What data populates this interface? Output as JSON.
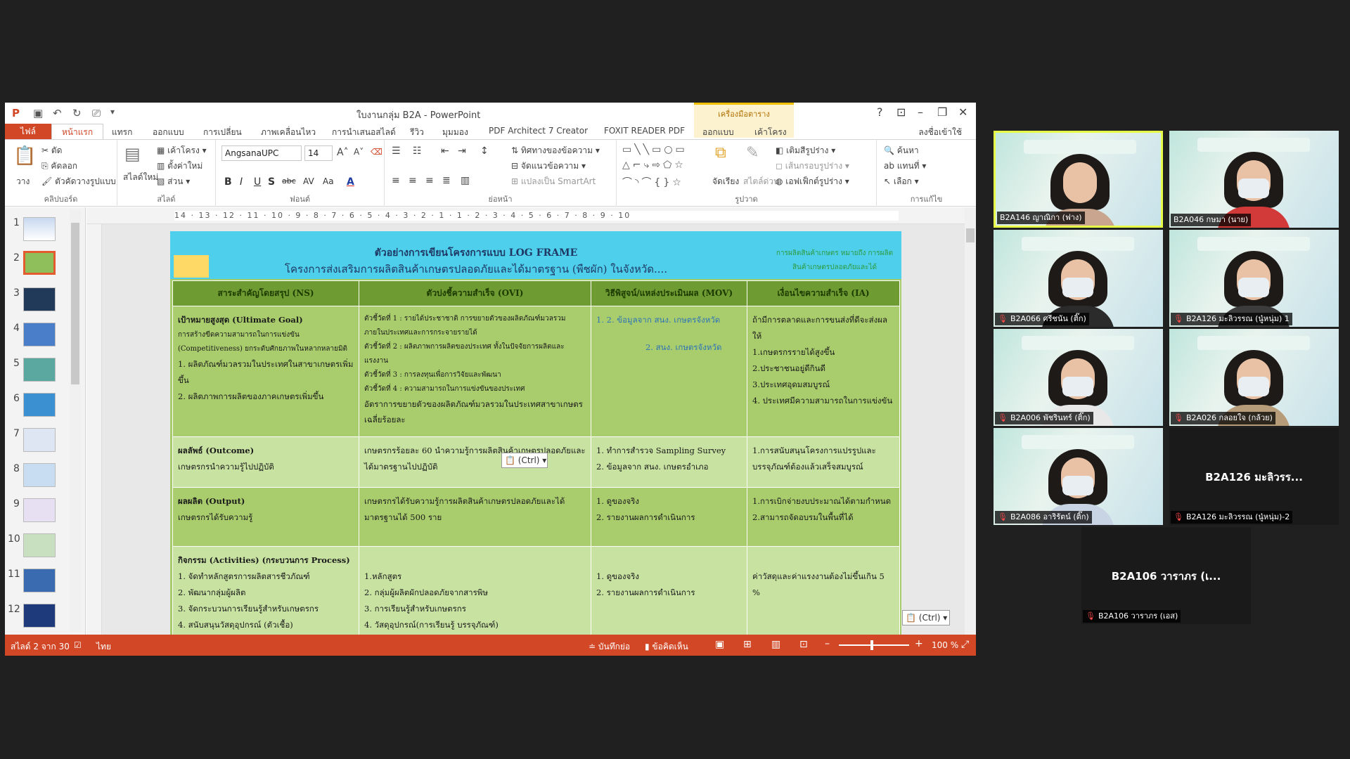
{
  "window": {
    "title": "ใบงานกลุ่ม B2A - PowerPoint",
    "context_tools": "เครื่องมือตาราง"
  },
  "tabs": [
    "ไฟล์",
    "หน้าแรก",
    "แทรก",
    "ออกแบบ",
    "การเปลี่ยน",
    "ภาพเคลื่อนไหว",
    "การนำเสนอสไลด์",
    "รีวิว",
    "มุมมอง",
    "PDF Architect 7 Creator",
    "FOXIT READER PDF",
    "ออกแบบ",
    "เค้าโครง"
  ],
  "signin": "ลงชื่อเข้าใช้",
  "ribbon": {
    "clipboard": {
      "label": "คลิปบอร์ด",
      "paste": "วาง",
      "cut": "ตัด",
      "copy": "คัดลอก",
      "format_painter": "ตัวคัดวางรูปแบบ"
    },
    "slides": {
      "label": "สไลด์",
      "new_slide": "สไลด์ใหม่",
      "layout": "เค้าโครง",
      "reset": "ตั้งค่าใหม่",
      "section": "ส่วน"
    },
    "font": {
      "label": "ฟอนต์",
      "name": "AngsanaUPC",
      "size": "14"
    },
    "paragraph": {
      "label": "ย่อหน้า",
      "text_direction": "ทิศทางของข้อความ",
      "align_text": "จัดแนวข้อความ",
      "smartart": "แปลงเป็น SmartArt"
    },
    "drawing": {
      "label": "รูปวาด",
      "arrange": "จัดเรียง",
      "quick_styles": "สไตล์ด่วน",
      "shape_fill": "เติมสีรูปร่าง",
      "shape_outline": "เส้นกรอบรูปร่าง",
      "shape_effects": "เอฟเฟ็กต์รูปร่าง"
    },
    "editing": {
      "label": "การแก้ไข",
      "find": "ค้นหา",
      "replace": "แทนที่",
      "select": "เลือก"
    }
  },
  "thumbnails": [
    "1",
    "2",
    "3",
    "4",
    "5",
    "6",
    "7",
    "8",
    "9",
    "10",
    "11",
    "12"
  ],
  "ruler_text": "14 · 13 · 12 · 11 · 10 · 9 · 8 · 7 · 6 · 5 · 4 · 3 · 2 · 1 · 1 · 2 · 3 · 4 · 5 · 6 · 7 · 8 · 9 · 10",
  "slide": {
    "title1": "ตัวอย่างการเขียนโครงการแบบ LOG FRAME",
    "title2": "โครงการส่งเสริมการผลิตสินค้าเกษตรปลอดภัยและได้มาตรฐาน (พืชผัก) ในจังหวัด....",
    "side_note": "การผลิตสินค้าเกษตร หมายถึง การผลิตสินค้าเกษตรปลอดภัยและได้",
    "headers": [
      "สาระสำคัญโดยสรุป (NS)",
      "ตัวบ่งชี้ความสำเร็จ (OVI)",
      "วิธีพิสูจน์/แหล่งประเมินผล (MOV)",
      "เงื่อนไขความสำเร็จ (IA)"
    ],
    "r1": {
      "ns_title": "เป้าหมายสูงสุด (Ultimate Goal)",
      "ns_lines": [
        "การสร้างขีดความสามารถในการแข่งขัน (Competitiveness) ยกระดับศักยภาพในหลากหลายมิติ",
        "1. ผลิตภัณฑ์มวลรวมในประเทศในสาขาเกษตรเพิ่มขึ้น",
        "2. ผลิตภาพการผลิตของภาคเกษตรเพิ่มขึ้น"
      ],
      "ovi_lines": [
        "ตัวชี้วัดที่ 1 : รายได้ประชาชาติ การขยายตัวของผลิตภัณฑ์มวลรวมภายในประเทศและการกระจายรายได้",
        "ตัวชี้วัดที่ 2 : ผลิตภาพการผลิตของประเทศ ทั้งในปัจจัยการผลิตและแรงงาน",
        "ตัวชี้วัดที่ 3 : การลงทุนเพื่อการวิจัยและพัฒนา",
        "ตัวชี้วัดที่ 4 : ความสามารถในการแข่งขันของประเทศ",
        "อัตราการขยายตัวของผลิตภัณฑ์มวลรวมในประเทศสาขาเกษตรเฉลี่ยร้อยละ"
      ],
      "mov_lines": [
        "1. 2. ข้อมูลจาก สนง. เกษตรจังหวัด",
        "2. สนง. เกษตรจังหวัด"
      ],
      "ia_lines": [
        "ถ้ามีการตลาดและการขนส่งที่ดีจะส่งผลให้",
        "1.เกษตรกรรายได้สูงขึ้น",
        "2.ประชาชนอยู่ดีกินดี",
        "3.ประเทศอุดมสมบูรณ์",
        "4. ประเทศมีความสามารถในการแข่งขัน"
      ]
    },
    "r2": {
      "ns_title": "ผลลัพธ์ (Outcome)",
      "ns_lines": [
        "เกษตรกรนำความรู้ไปปฏิบัติ"
      ],
      "ovi_lines": [
        "เกษตรกรร้อยละ 60 นำความรู้การผลิตสินค้าเกษตรปลอดภัยและได้มาตรฐานไปปฏิบัติ"
      ],
      "mov_lines": [
        "1. ทำการสำรวจ Sampling Survey",
        "2. ข้อมูลจาก สนง. เกษตรอำเภอ"
      ],
      "ia_lines": [
        "1.การสนับสนุนโครงการแปรรูปและบรรจุภัณฑ์ต้องแล้วเสร็จสมบูรณ์"
      ]
    },
    "r3": {
      "ns_title": "ผลผลิต (Output)",
      "ns_lines": [
        "เกษตรกรได้รับความรู้"
      ],
      "ovi_lines": [
        "เกษตรกรได้รับความรู้การผลิตสินค้าเกษตรปลอดภัยและได้มาตรฐานได้ 500 ราย"
      ],
      "mov_lines": [
        "1. ดูของจริง",
        "2. รายงานผลการดำเนินการ"
      ],
      "ia_lines": [
        "1.การเบิกจ่ายงบประมาณได้ตามกำหนด",
        "2.สามารถจัดอบรมในพื้นที่ได้"
      ]
    },
    "r4": {
      "ns_title": "กิจกรรม (Activities) (กระบวนการ Process)",
      "ns_lines": [
        "1. จัดทำหลักสูตรการผลิตสารชีวภัณฑ์",
        "2. พัฒนากลุ่มผู้ผลิต",
        "3. จัดกระบวนการเรียนรู้สำหรับเกษตรกร",
        "4. สนับสนุนวัสดุอุปกรณ์ (ตัวเชื้อ)"
      ],
      "ovi_lines": [
        "1.หลักสูตร",
        "2. กลุ่มผู้ผลิตผักปลอดภัยจากสารพิษ",
        "3. การเรียนรู้สำหรับเกษตรกร",
        "4. วัสดุอุปกรณ์(การเรียนรู้ บรรจุภัณฑ์)"
      ],
      "mov_lines": [
        "1. ดูของจริง",
        "2. รายงานผลการดำเนินการ"
      ],
      "ia_lines": [
        "ค่าวัสดุและค่าแรงงานต้องไม่ขึ้นเกิน 5 %"
      ]
    }
  },
  "paste_tag": "(Ctrl)",
  "status": {
    "slide_of": "สไลด์ 2 จาก 30",
    "language": "ไทย",
    "notes": "บันทึกย่อ",
    "comments": "ข้อคิดเห็น",
    "zoom": "100 %"
  },
  "participants": [
    {
      "name": "B2A146 ญาณิกา (ฟาง)",
      "muted": false,
      "active": true,
      "mask": false,
      "shirt": "#c9a58f"
    },
    {
      "name": "B2A046 กษมา (นาย)",
      "muted": false,
      "active": false,
      "mask": true,
      "shirt": "#d23a3a"
    },
    {
      "name": "B2A066 ศรีชนัน (ติ๊ก)",
      "muted": true,
      "active": false,
      "mask": true,
      "shirt": "#2b2b2b"
    },
    {
      "name": "B2A126 มะลิวรรณ (นู๋หนุ่ม) 1",
      "muted": true,
      "active": false,
      "mask": true,
      "shirt": "#3c3c3c"
    },
    {
      "name": "B2A006 พัชรินทร์ (ติ๊ก)",
      "muted": true,
      "active": false,
      "mask": true,
      "shirt": "#e8e8e8"
    },
    {
      "name": "B2A026 กลอยใจ (กล้วย)",
      "muted": true,
      "active": false,
      "mask": true,
      "shirt": "#b79c7a"
    },
    {
      "name": "B2A086 อาริรัตน์ (ติ๊ก)",
      "muted": true,
      "active": false,
      "mask": true,
      "shirt": "#c8d4e4"
    }
  ],
  "blank_tiles": [
    {
      "big": "B2A126 มะลิวรร...",
      "name": "B2A126 มะลิวรรณ (นู๋หนุ่ม)-2"
    },
    {
      "big": "B2A106 วาราภร (เ...",
      "name": "B2A106 วาราภร (เอส)"
    }
  ]
}
